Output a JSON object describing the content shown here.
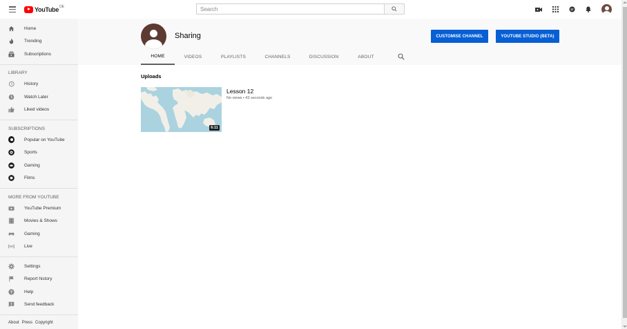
{
  "header": {
    "logo_text": "YouTube",
    "logo_country": "DE",
    "search_placeholder": "Search"
  },
  "sidebar": {
    "main": [
      {
        "label": "Home",
        "icon": "home-icon"
      },
      {
        "label": "Trending",
        "icon": "flame-icon"
      },
      {
        "label": "Subscriptions",
        "icon": "subscriptions-icon"
      }
    ],
    "library_title": "LIBRARY",
    "library": [
      {
        "label": "History",
        "icon": "history-icon"
      },
      {
        "label": "Watch Later",
        "icon": "clock-icon"
      },
      {
        "label": "Liked videos",
        "icon": "thumbs-up-icon"
      }
    ],
    "subscriptions_title": "SUBSCRIPTIONS",
    "subscriptions": [
      {
        "label": "Popular on YouTube"
      },
      {
        "label": "Sports"
      },
      {
        "label": "Gaming"
      },
      {
        "label": "Films"
      }
    ],
    "more_title": "MORE FROM YOUTUBE",
    "more": [
      {
        "label": "YouTube Premium",
        "icon": "youtube-premium-icon"
      },
      {
        "label": "Movies & Shows",
        "icon": "film-strip-icon"
      },
      {
        "label": "Gaming",
        "icon": "gamepad-icon"
      },
      {
        "label": "Live",
        "icon": "live-icon"
      }
    ],
    "settings": [
      {
        "label": "Settings",
        "icon": "gear-icon"
      },
      {
        "label": "Report history",
        "icon": "flag-icon"
      },
      {
        "label": "Help",
        "icon": "help-icon"
      },
      {
        "label": "Send feedback",
        "icon": "feedback-icon"
      }
    ],
    "footer": {
      "about": "About",
      "press": "Press",
      "copyright": "Copyright"
    }
  },
  "channel": {
    "name": "Sharing",
    "customise_label": "CUSTOMISE CHANNEL",
    "studio_label": "YOUTUBE STUDIO (BETA)",
    "tabs": [
      "HOME",
      "VIDEOS",
      "PLAYLISTS",
      "CHANNELS",
      "DISCUSSION",
      "ABOUT"
    ]
  },
  "content": {
    "section_title": "Uploads",
    "video": {
      "title": "Lesson 12",
      "meta": "No views • 43 seconds ago",
      "duration": "6:11"
    }
  },
  "colors": {
    "brand_red": "#ff0000",
    "primary_blue": "#065fd4",
    "sidebar_bg": "#f5f5f5"
  }
}
